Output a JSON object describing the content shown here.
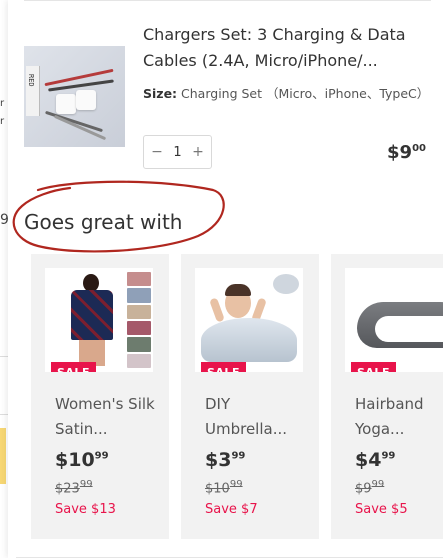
{
  "background_page": {
    "fragments": [
      "r",
      "r",
      "9"
    ]
  },
  "cart_item": {
    "title": "Chargers Set: 3 Charging & Data Cables (2.4A, Micro/iPhone/...",
    "size_label": "Size:",
    "size_value": "Charging Set （Micro、iPhone、TypeC）",
    "quantity": "1",
    "price_main": "$9",
    "price_cents": "00",
    "thumb_box_text": "RED"
  },
  "recommendations": {
    "section_title": "Goes great with",
    "annotation_color": "#b0271f",
    "sale_badge_color": "#e8144b",
    "items": [
      {
        "badge": "SALE",
        "name": "Women's Silk Satin...",
        "price_main": "$10",
        "price_cents": "99",
        "compare_main": "$23",
        "compare_cents": "99",
        "save": "Save $13"
      },
      {
        "badge": "SALE",
        "name": "DIY Umbrella...",
        "price_main": "$3",
        "price_cents": "99",
        "compare_main": "$10",
        "compare_cents": "99",
        "save": "Save $7"
      },
      {
        "badge": "SALE",
        "name": "Hairband Yoga...",
        "price_main": "$4",
        "price_cents": "99",
        "compare_main": "$9",
        "compare_cents": "99",
        "save": "Save $5"
      }
    ]
  },
  "icons": {
    "minus": "−",
    "plus": "+"
  }
}
